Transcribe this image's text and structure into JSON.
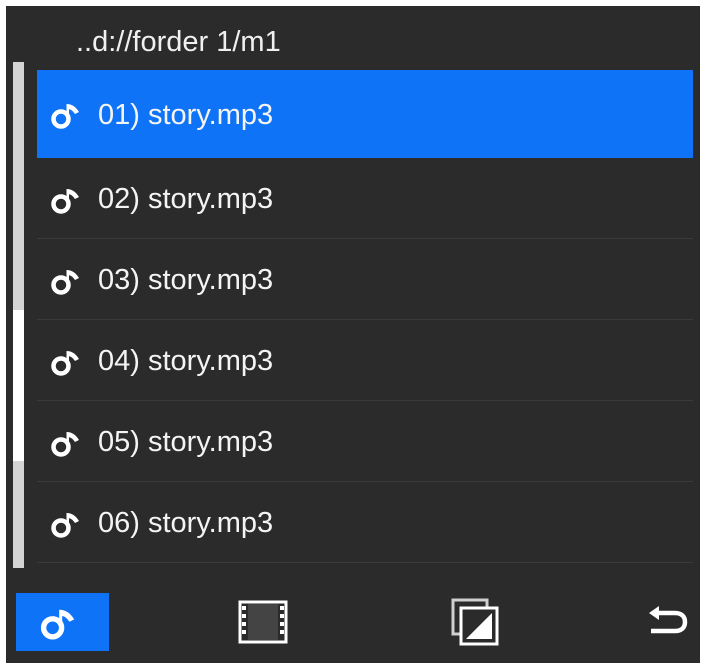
{
  "header": {
    "path": "..d://forder 1/m1"
  },
  "files": [
    {
      "label": "01) story.mp3",
      "icon": "music-note-icon",
      "selected": true
    },
    {
      "label": "02) story.mp3",
      "icon": "music-note-icon",
      "selected": false
    },
    {
      "label": "03) story.mp3",
      "icon": "music-note-icon",
      "selected": false
    },
    {
      "label": "04) story.mp3",
      "icon": "music-note-icon",
      "selected": false
    },
    {
      "label": "05) story.mp3",
      "icon": "music-note-icon",
      "selected": false
    },
    {
      "label": "06) story.mp3",
      "icon": "music-note-icon",
      "selected": false
    }
  ],
  "scrollbar": {
    "position_fraction": 0.7
  },
  "toolbar": {
    "tabs": [
      {
        "icon": "music-note-icon",
        "active": true
      },
      {
        "icon": "film-strip-icon",
        "active": false
      },
      {
        "icon": "photo-gallery-icon",
        "active": false
      },
      {
        "icon": "back-arrow-icon",
        "active": false
      }
    ]
  },
  "colors": {
    "background": "#2b2b2b",
    "selection": "#0e73f6",
    "text": "#f4f4f4"
  }
}
